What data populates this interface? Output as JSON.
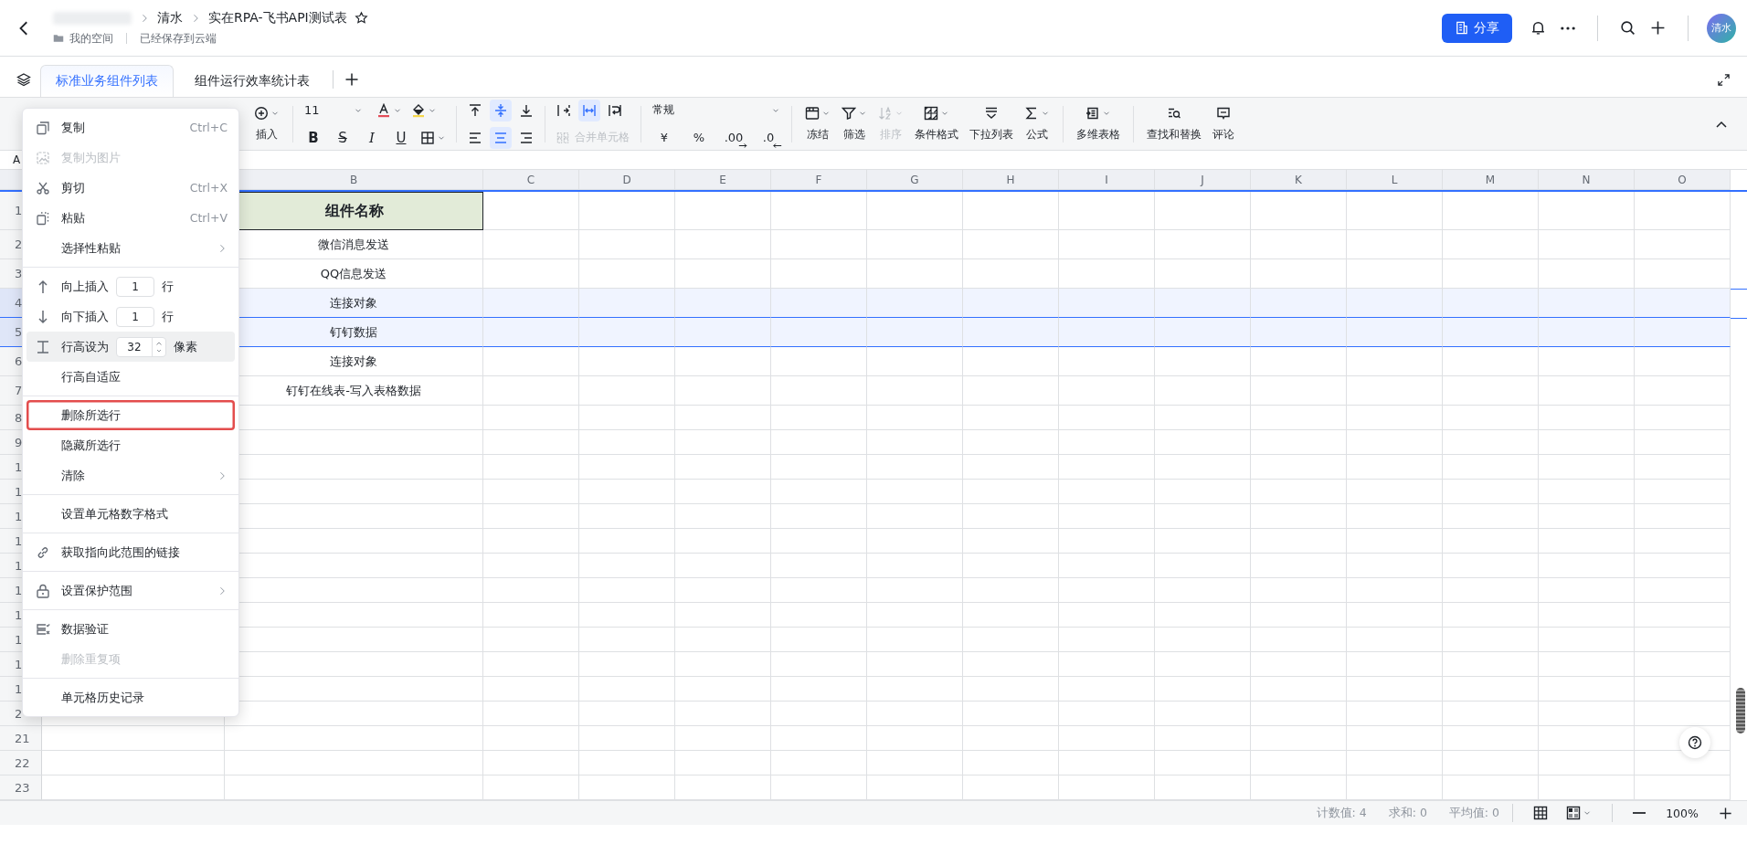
{
  "header": {
    "breadcrumb": [
      "清水"
    ],
    "title": "实在RPA-飞书API测试表",
    "starred": false,
    "location": "我的空间",
    "save_status": "已经保存到云端",
    "share_label": "分享",
    "avatar": "清水"
  },
  "sheets": [
    {
      "label": "标准业务组件列表",
      "selected": true
    },
    {
      "label": "组件运行效率统计表",
      "selected": false
    }
  ],
  "toolbar": {
    "insert_label": "插入",
    "font_size": "11",
    "format_buttons": [
      {
        "glyph": "B"
      },
      {
        "glyph": "S"
      },
      {
        "glyph": "I"
      },
      {
        "glyph": "U"
      }
    ],
    "vertical_align": [
      {
        "selected": false
      },
      {
        "selected": true
      },
      {
        "selected": false
      }
    ],
    "horizontal_align": [
      {
        "selected": false
      },
      {
        "selected": true
      },
      {
        "selected": false
      }
    ],
    "wrap_modes": [
      {
        "selected": false
      },
      {
        "selected": true
      },
      {
        "selected": false
      }
    ],
    "merge": {
      "label": "合并单元格",
      "disabled": true
    },
    "number_format": "常规",
    "number_buttons": [
      {
        "glyph": "¥"
      },
      {
        "glyph": "%"
      },
      {
        "glyph": ".00"
      },
      {
        "glyph": ".0"
      }
    ],
    "tool_groups": [
      [
        {
          "label": "冻结",
          "has_menu": true,
          "disabled": false
        },
        {
          "label": "筛选",
          "has_menu": true,
          "disabled": false
        },
        {
          "label": "排序",
          "has_menu": true,
          "disabled": true
        },
        {
          "label": "条件格式",
          "has_menu": true,
          "disabled": false
        },
        {
          "label": "下拉列表",
          "has_menu": false,
          "disabled": false
        },
        {
          "label": "公式",
          "has_menu": true,
          "disabled": false
        }
      ],
      [
        {
          "label": "多维表格",
          "has_menu": true,
          "disabled": false
        }
      ],
      [
        {
          "label": "查找和替换",
          "has_menu": false,
          "disabled": false
        },
        {
          "label": "评论",
          "has_menu": false,
          "disabled": false
        }
      ]
    ]
  },
  "name_box": "A",
  "columns": [
    "B",
    "C",
    "D",
    "E",
    "F",
    "G",
    "H",
    "I",
    "J",
    "K",
    "L",
    "M",
    "N",
    "O"
  ],
  "rows": [
    {
      "label": "1",
      "b": "组件名称",
      "kind": "header",
      "selected": false
    },
    {
      "label": "2",
      "b": "微信消息发送",
      "kind": "data",
      "selected": false
    },
    {
      "label": "3",
      "b": "QQ信息发送",
      "kind": "data",
      "selected": false
    },
    {
      "label": "4",
      "b": "连接对象",
      "kind": "data",
      "selected": true
    },
    {
      "label": "5",
      "b": "钉钉数据",
      "kind": "data",
      "selected": true
    },
    {
      "label": "6",
      "b": "连接对象",
      "kind": "data",
      "selected": false
    },
    {
      "label": "7",
      "b": "钉钉在线表-写入表格数据",
      "kind": "data",
      "selected": false
    },
    {
      "label": "8",
      "kind": "empty",
      "selected": false
    },
    {
      "label": "9",
      "kind": "empty",
      "selected": false
    },
    {
      "label": "1",
      "kind": "empty",
      "selected": false
    },
    {
      "label": "1",
      "kind": "empty",
      "selected": false
    },
    {
      "label": "1",
      "kind": "empty",
      "selected": false
    },
    {
      "label": "1",
      "kind": "empty",
      "selected": false
    },
    {
      "label": "1",
      "kind": "empty",
      "selected": false
    },
    {
      "label": "1",
      "kind": "empty",
      "selected": false
    },
    {
      "label": "1",
      "kind": "empty",
      "selected": false
    },
    {
      "label": "1",
      "kind": "empty",
      "selected": false
    },
    {
      "label": "1",
      "kind": "empty",
      "selected": false
    },
    {
      "label": "1",
      "kind": "empty",
      "selected": false
    },
    {
      "label": "2",
      "kind": "empty",
      "selected": false
    },
    {
      "label": "21",
      "kind": "empty",
      "selected": false
    },
    {
      "label": "22",
      "kind": "empty",
      "selected": false
    },
    {
      "label": "23",
      "kind": "empty",
      "selected": false
    }
  ],
  "context_menu": [
    [
      {
        "label": "复制",
        "kind": "plain",
        "shortcut": "Ctrl+C",
        "disabled": false
      },
      {
        "label": "复制为图片",
        "kind": "plain",
        "disabled": true
      },
      {
        "label": "剪切",
        "kind": "plain",
        "shortcut": "Ctrl+X",
        "disabled": false
      },
      {
        "label": "粘贴",
        "kind": "plain",
        "shortcut": "Ctrl+V",
        "disabled": false
      },
      {
        "label": "选择性粘贴",
        "kind": "plain",
        "submenu": true,
        "disabled": false
      }
    ],
    [
      {
        "label": "向上插入",
        "kind": "input",
        "value": "1",
        "unit": "行",
        "disabled": false
      },
      {
        "label": "向下插入",
        "kind": "input",
        "value": "1",
        "unit": "行",
        "disabled": false
      },
      {
        "label": "行高设为",
        "kind": "spinner",
        "value": "32",
        "unit": "像素",
        "hovered": true,
        "disabled": false
      },
      {
        "label": "行高自适应",
        "kind": "plain",
        "disabled": false
      }
    ],
    [
      {
        "label": "删除所选行",
        "kind": "plain",
        "outlined": true,
        "disabled": false
      },
      {
        "label": "隐藏所选行",
        "kind": "plain",
        "disabled": false
      },
      {
        "label": "清除",
        "kind": "plain",
        "submenu": true,
        "disabled": false
      }
    ],
    [
      {
        "label": "设置单元格数字格式",
        "kind": "plain",
        "disabled": false
      }
    ],
    [
      {
        "label": "获取指向此范围的链接",
        "kind": "plain",
        "disabled": false
      }
    ],
    [
      {
        "label": "设置保护范围",
        "kind": "plain",
        "submenu": true,
        "disabled": false
      }
    ],
    [
      {
        "label": "数据验证",
        "kind": "plain",
        "disabled": false
      },
      {
        "label": "删除重复项",
        "kind": "plain",
        "disabled": true
      }
    ],
    [
      {
        "label": "单元格历史记录",
        "kind": "plain",
        "disabled": false
      }
    ]
  ],
  "status_bar": {
    "count": "计数值: 4",
    "sum": "求和: 0",
    "average": "平均值: 0",
    "zoom": "100%"
  }
}
